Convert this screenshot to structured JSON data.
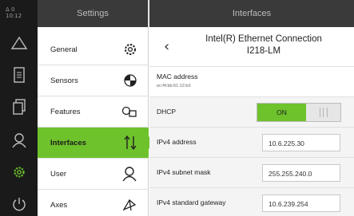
{
  "status_bar": {
    "signal": "Δ 0",
    "time": "10:12"
  },
  "rail": {
    "items": [
      {
        "icon": "warning-icon"
      },
      {
        "icon": "document-icon"
      },
      {
        "icon": "copy-icon"
      },
      {
        "icon": "user-icon"
      },
      {
        "icon": "gear-icon",
        "active": true
      },
      {
        "icon": "power-icon"
      }
    ]
  },
  "settings": {
    "header": "Settings",
    "items": [
      {
        "label": "General",
        "icon": "gear-icon"
      },
      {
        "label": "Sensors",
        "icon": "sensor-icon"
      },
      {
        "label": "Features",
        "icon": "key-icon"
      },
      {
        "label": "Interfaces",
        "icon": "network-icon",
        "active": true
      },
      {
        "label": "User",
        "icon": "user-icon"
      },
      {
        "label": "Axes",
        "icon": "axes-icon"
      }
    ]
  },
  "interfaces": {
    "header": "Interfaces",
    "title_line1": "Intel(R) Ethernet Connection",
    "title_line2": "I218-LM",
    "mac_label": "MAC address",
    "mac_value": "ec:f4:bb:61:12:b3",
    "dhcp_label": "DHCP",
    "dhcp_state": "ON",
    "ipv4_label": "IPv4 address",
    "ipv4_value": "10.6.225.30",
    "mask_label": "IPv4 subnet mask",
    "mask_value": "255.255.240.0",
    "gateway_label": "IPv4 standard gateway",
    "gateway_value": "10.6.239.254"
  },
  "colors": {
    "accent": "#6ec22c",
    "rail": "#1a1a1a",
    "header": "#3a3a3a"
  }
}
